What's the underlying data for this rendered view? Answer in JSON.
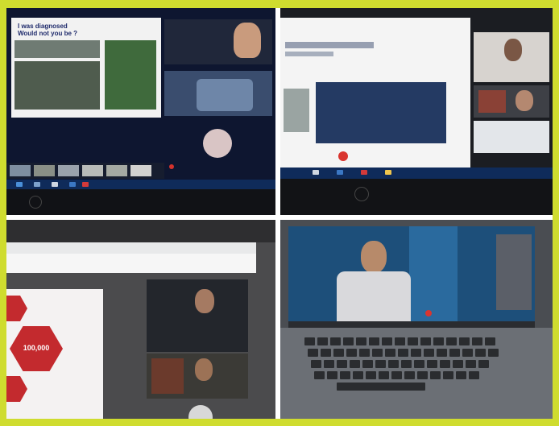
{
  "panel_top_left": {
    "slide_text": "I was diagnosed\nWould not you be ?"
  },
  "panel_bottom_left": {
    "stat_label": "100,000"
  }
}
